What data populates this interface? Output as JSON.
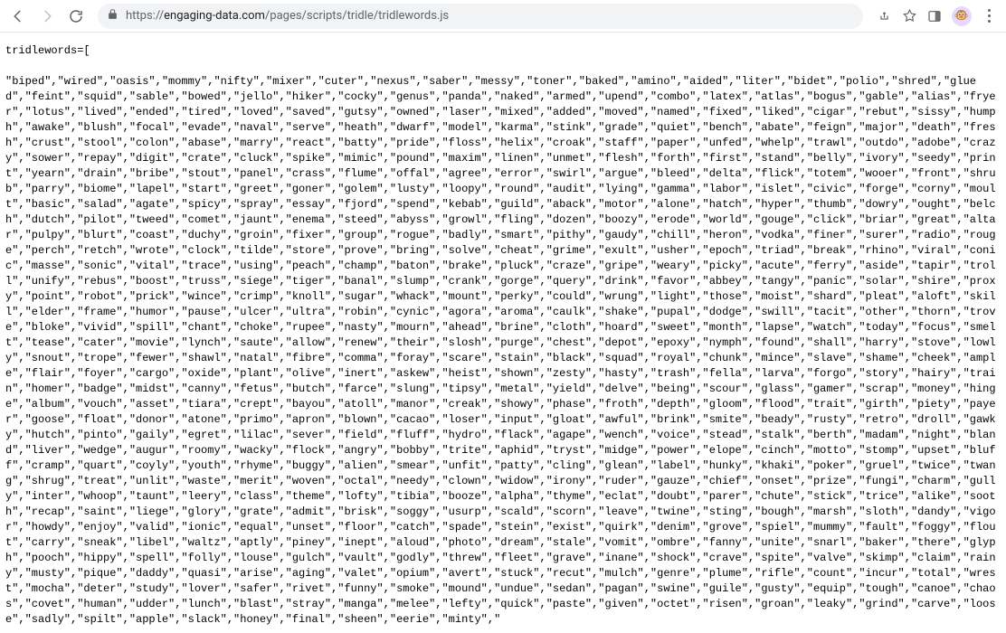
{
  "browser": {
    "url_scheme": "https://",
    "url_host": "engaging-data.com",
    "url_path": "/pages/scripts/tridle/tridlewords.js"
  },
  "file": {
    "prefix": "tridlewords=[\n\n",
    "words": [
      "biped",
      "wired",
      "oasis",
      "mommy",
      "nifty",
      "mixer",
      "cuter",
      "nexus",
      "saber",
      "messy",
      "toner",
      "baked",
      "amino",
      "aided",
      "liter",
      "bidet",
      "polio",
      "shred",
      "glued",
      "feint",
      "squid",
      "sable",
      "bowed",
      "jello",
      "hiker",
      "cocky",
      "genus",
      "panda",
      "naked",
      "armed",
      "upend",
      "combo",
      "latex",
      "atlas",
      "bogus",
      "gable",
      "alias",
      "fryer",
      "lotus",
      "lived",
      "ended",
      "tired",
      "loved",
      "saved",
      "gutsy",
      "owned",
      "laser",
      "mixed",
      "added",
      "moved",
      "named",
      "fixed",
      "liked",
      "cigar",
      "rebut",
      "sissy",
      "humph",
      "awake",
      "blush",
      "focal",
      "evade",
      "naval",
      "serve",
      "heath",
      "dwarf",
      "model",
      "karma",
      "stink",
      "grade",
      "quiet",
      "bench",
      "abate",
      "feign",
      "major",
      "death",
      "fresh",
      "crust",
      "stool",
      "colon",
      "abase",
      "marry",
      "react",
      "batty",
      "pride",
      "floss",
      "helix",
      "croak",
      "staff",
      "paper",
      "unfed",
      "whelp",
      "trawl",
      "outdo",
      "adobe",
      "crazy",
      "sower",
      "repay",
      "digit",
      "crate",
      "cluck",
      "spike",
      "mimic",
      "pound",
      "maxim",
      "linen",
      "unmet",
      "flesh",
      "forth",
      "first",
      "stand",
      "belly",
      "ivory",
      "seedy",
      "print",
      "yearn",
      "drain",
      "bribe",
      "stout",
      "panel",
      "crass",
      "flume",
      "offal",
      "agree",
      "error",
      "swirl",
      "argue",
      "bleed",
      "delta",
      "flick",
      "totem",
      "wooer",
      "front",
      "shrub",
      "parry",
      "biome",
      "lapel",
      "start",
      "greet",
      "goner",
      "golem",
      "lusty",
      "loopy",
      "round",
      "audit",
      "lying",
      "gamma",
      "labor",
      "islet",
      "civic",
      "forge",
      "corny",
      "moult",
      "basic",
      "salad",
      "agate",
      "spicy",
      "spray",
      "essay",
      "fjord",
      "spend",
      "kebab",
      "guild",
      "aback",
      "motor",
      "alone",
      "hatch",
      "hyper",
      "thumb",
      "dowry",
      "ought",
      "belch",
      "dutch",
      "pilot",
      "tweed",
      "comet",
      "jaunt",
      "enema",
      "steed",
      "abyss",
      "growl",
      "fling",
      "dozen",
      "boozy",
      "erode",
      "world",
      "gouge",
      "click",
      "briar",
      "great",
      "altar",
      "pulpy",
      "blurt",
      "coast",
      "duchy",
      "groin",
      "fixer",
      "group",
      "rogue",
      "badly",
      "smart",
      "pithy",
      "gaudy",
      "chill",
      "heron",
      "vodka",
      "finer",
      "surer",
      "radio",
      "rouge",
      "perch",
      "retch",
      "wrote",
      "clock",
      "tilde",
      "store",
      "prove",
      "bring",
      "solve",
      "cheat",
      "grime",
      "exult",
      "usher",
      "epoch",
      "triad",
      "break",
      "rhino",
      "viral",
      "conic",
      "masse",
      "sonic",
      "vital",
      "trace",
      "using",
      "peach",
      "champ",
      "baton",
      "brake",
      "pluck",
      "craze",
      "gripe",
      "weary",
      "picky",
      "acute",
      "ferry",
      "aside",
      "tapir",
      "troll",
      "unify",
      "rebus",
      "boost",
      "truss",
      "siege",
      "tiger",
      "banal",
      "slump",
      "crank",
      "gorge",
      "query",
      "drink",
      "favor",
      "abbey",
      "tangy",
      "panic",
      "solar",
      "shire",
      "proxy",
      "point",
      "robot",
      "prick",
      "wince",
      "crimp",
      "knoll",
      "sugar",
      "whack",
      "mount",
      "perky",
      "could",
      "wrung",
      "light",
      "those",
      "moist",
      "shard",
      "pleat",
      "aloft",
      "skill",
      "elder",
      "frame",
      "humor",
      "pause",
      "ulcer",
      "ultra",
      "robin",
      "cynic",
      "agora",
      "aroma",
      "caulk",
      "shake",
      "pupal",
      "dodge",
      "swill",
      "tacit",
      "other",
      "thorn",
      "trove",
      "bloke",
      "vivid",
      "spill",
      "chant",
      "choke",
      "rupee",
      "nasty",
      "mourn",
      "ahead",
      "brine",
      "cloth",
      "hoard",
      "sweet",
      "month",
      "lapse",
      "watch",
      "today",
      "focus",
      "smelt",
      "tease",
      "cater",
      "movie",
      "lynch",
      "saute",
      "allow",
      "renew",
      "their",
      "slosh",
      "purge",
      "chest",
      "depot",
      "epoxy",
      "nymph",
      "found",
      "shall",
      "harry",
      "stove",
      "lowly",
      "snout",
      "trope",
      "fewer",
      "shawl",
      "natal",
      "fibre",
      "comma",
      "foray",
      "scare",
      "stain",
      "black",
      "squad",
      "royal",
      "chunk",
      "mince",
      "slave",
      "shame",
      "cheek",
      "ample",
      "flair",
      "foyer",
      "cargo",
      "oxide",
      "plant",
      "olive",
      "inert",
      "askew",
      "heist",
      "shown",
      "zesty",
      "hasty",
      "trash",
      "fella",
      "larva",
      "forgo",
      "story",
      "hairy",
      "train",
      "homer",
      "badge",
      "midst",
      "canny",
      "fetus",
      "butch",
      "farce",
      "slung",
      "tipsy",
      "metal",
      "yield",
      "delve",
      "being",
      "scour",
      "glass",
      "gamer",
      "scrap",
      "money",
      "hinge",
      "album",
      "vouch",
      "asset",
      "tiara",
      "crept",
      "bayou",
      "atoll",
      "manor",
      "creak",
      "showy",
      "phase",
      "froth",
      "depth",
      "gloom",
      "flood",
      "trait",
      "girth",
      "piety",
      "payer",
      "goose",
      "float",
      "donor",
      "atone",
      "primo",
      "apron",
      "blown",
      "cacao",
      "loser",
      "input",
      "gloat",
      "awful",
      "brink",
      "smite",
      "beady",
      "rusty",
      "retro",
      "droll",
      "gawky",
      "hutch",
      "pinto",
      "gaily",
      "egret",
      "lilac",
      "sever",
      "field",
      "fluff",
      "hydro",
      "flack",
      "agape",
      "wench",
      "voice",
      "stead",
      "stalk",
      "berth",
      "madam",
      "night",
      "bland",
      "liver",
      "wedge",
      "augur",
      "roomy",
      "wacky",
      "flock",
      "angry",
      "bobby",
      "trite",
      "aphid",
      "tryst",
      "midge",
      "power",
      "elope",
      "cinch",
      "motto",
      "stomp",
      "upset",
      "bluff",
      "cramp",
      "quart",
      "coyly",
      "youth",
      "rhyme",
      "buggy",
      "alien",
      "smear",
      "unfit",
      "patty",
      "cling",
      "glean",
      "label",
      "hunky",
      "khaki",
      "poker",
      "gruel",
      "twice",
      "twang",
      "shrug",
      "treat",
      "unlit",
      "waste",
      "merit",
      "woven",
      "octal",
      "needy",
      "clown",
      "widow",
      "irony",
      "ruder",
      "gauze",
      "chief",
      "onset",
      "prize",
      "fungi",
      "charm",
      "gully",
      "inter",
      "whoop",
      "taunt",
      "leery",
      "class",
      "theme",
      "lofty",
      "tibia",
      "booze",
      "alpha",
      "thyme",
      "eclat",
      "doubt",
      "parer",
      "chute",
      "stick",
      "trice",
      "alike",
      "sooth",
      "recap",
      "saint",
      "liege",
      "glory",
      "grate",
      "admit",
      "brisk",
      "soggy",
      "usurp",
      "scald",
      "scorn",
      "leave",
      "twine",
      "sting",
      "bough",
      "marsh",
      "sloth",
      "dandy",
      "vigor",
      "howdy",
      "enjoy",
      "valid",
      "ionic",
      "equal",
      "unset",
      "floor",
      "catch",
      "spade",
      "stein",
      "exist",
      "quirk",
      "denim",
      "grove",
      "spiel",
      "mummy",
      "fault",
      "foggy",
      "flout",
      "carry",
      "sneak",
      "libel",
      "waltz",
      "aptly",
      "piney",
      "inept",
      "aloud",
      "photo",
      "dream",
      "stale",
      "vomit",
      "ombre",
      "fanny",
      "unite",
      "snarl",
      "baker",
      "there",
      "glyph",
      "pooch",
      "hippy",
      "spell",
      "folly",
      "louse",
      "gulch",
      "vault",
      "godly",
      "threw",
      "fleet",
      "grave",
      "inane",
      "shock",
      "crave",
      "spite",
      "valve",
      "skimp",
      "claim",
      "rainy",
      "musty",
      "pique",
      "daddy",
      "quasi",
      "arise",
      "aging",
      "valet",
      "opium",
      "avert",
      "stuck",
      "recut",
      "mulch",
      "genre",
      "plume",
      "rifle",
      "count",
      "incur",
      "total",
      "wrest",
      "mocha",
      "deter",
      "study",
      "lover",
      "safer",
      "rivet",
      "funny",
      "smoke",
      "mound",
      "undue",
      "sedan",
      "pagan",
      "swine",
      "guile",
      "gusty",
      "equip",
      "tough",
      "canoe",
      "chaos",
      "covet",
      "human",
      "udder",
      "lunch",
      "blast",
      "stray",
      "manga",
      "melee",
      "lefty",
      "quick",
      "paste",
      "given",
      "octet",
      "risen",
      "groan",
      "leaky",
      "grind",
      "carve",
      "loose",
      "sadly",
      "spilt",
      "apple",
      "slack",
      "honey",
      "final",
      "sheen",
      "eerie",
      "minty"
    ]
  }
}
